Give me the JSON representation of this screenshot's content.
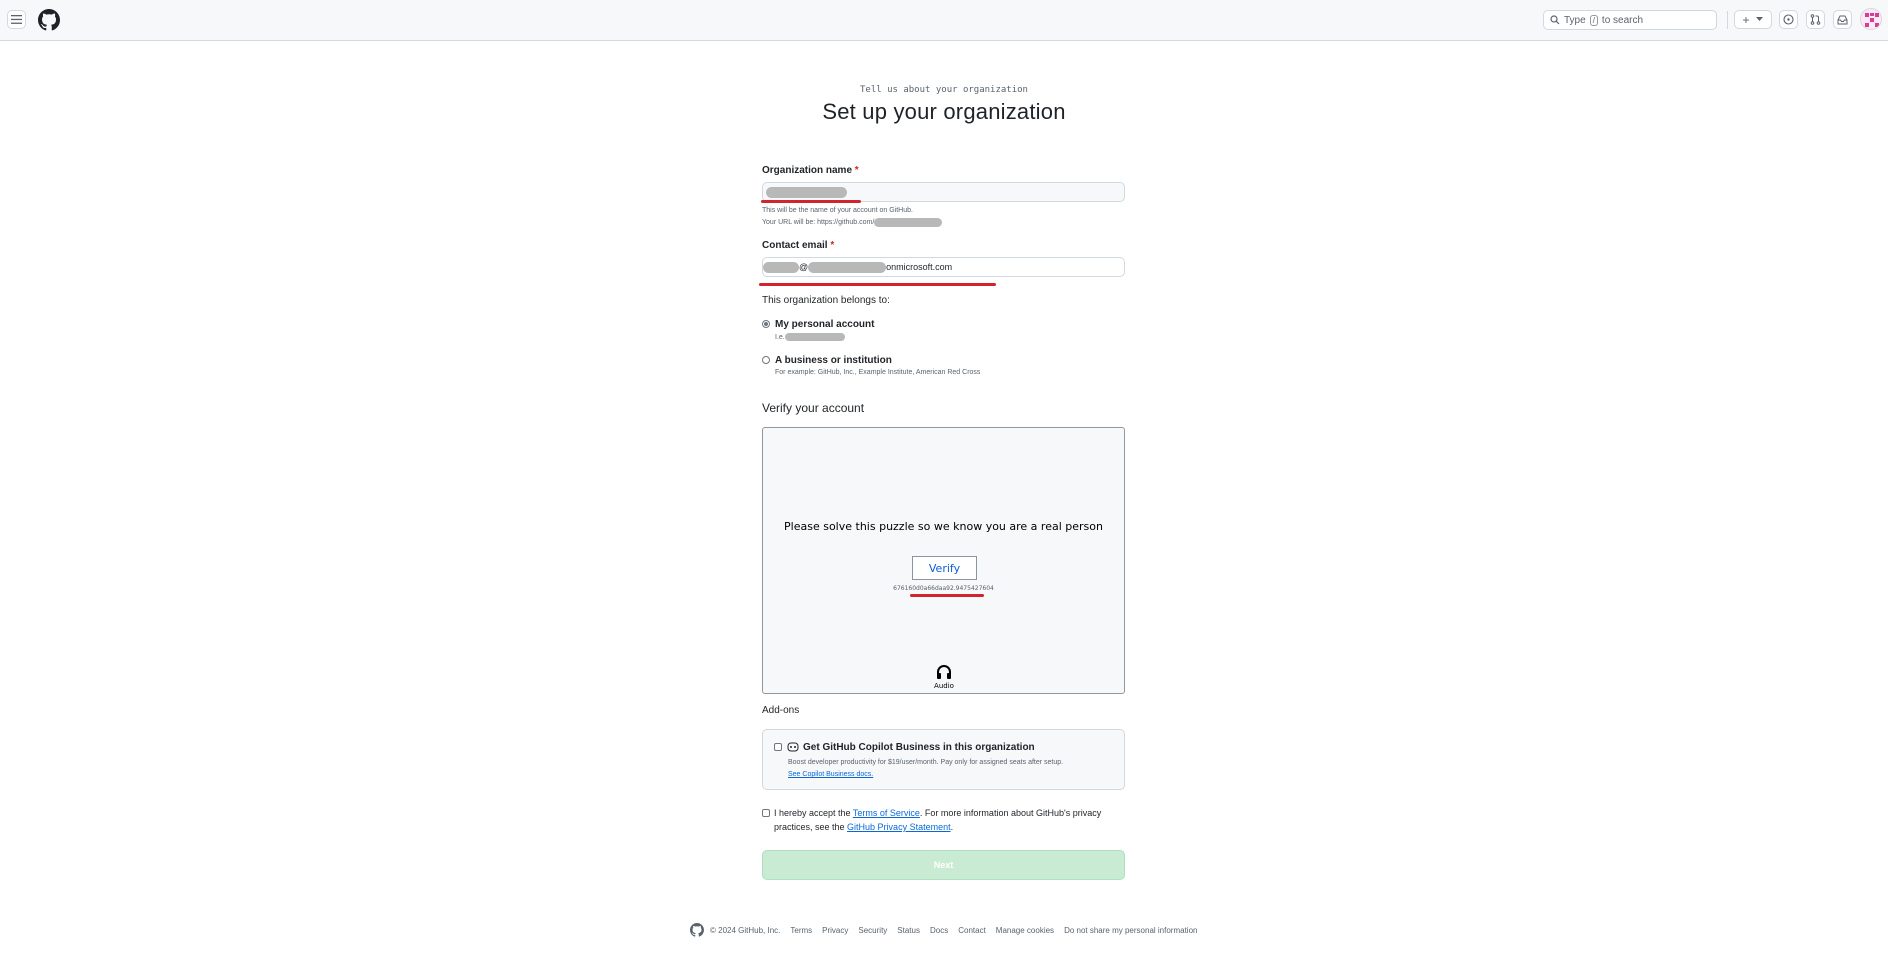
{
  "header": {
    "search_prefix": "Type",
    "search_key": "/",
    "search_suffix": "to search",
    "create_label": "+"
  },
  "page": {
    "subtitle": "Tell us about your organization",
    "title": "Set up your organization"
  },
  "form": {
    "org_name_label": "Organization name",
    "required_mark": "*",
    "org_name_help_1": "This will be the name of your account on GitHub.",
    "org_name_help_2": "Your URL will be: https://github.com/",
    "email_label": "Contact email",
    "email_value_suffix": "onmicrosoft.com",
    "email_at": "@",
    "belongs_label": "This organization belongs to:",
    "belongs_options": [
      {
        "title": "My personal account",
        "desc": "I.e.",
        "checked": true
      },
      {
        "title": "A business or institution",
        "desc": "For example: GitHub, Inc., Example Institute, American Red Cross",
        "checked": false
      }
    ],
    "verify_title": "Verify your account",
    "captcha_message": "Please solve this puzzle so we know you are a real person",
    "verify_button": "Verify",
    "captcha_id": "676160d0a66daa92.9475427604",
    "audio_label": "Audio",
    "addons_title": "Add-ons",
    "addon_title": "Get GitHub Copilot Business in this organization",
    "addon_desc": "Boost developer productivity for $19/user/month. Pay only for assigned seats after setup.",
    "addon_link": "See Copilot Business docs.",
    "terms_prefix": "I hereby accept the ",
    "terms_link": "Terms of Service",
    "terms_middle": ". For more information about GitHub's privacy practices, see the ",
    "privacy_link": "GitHub Privacy Statement",
    "terms_suffix": ".",
    "next_button": "Next"
  },
  "footer": {
    "copyright": "© 2024 GitHub, Inc.",
    "links": [
      "Terms",
      "Privacy",
      "Security",
      "Status",
      "Docs",
      "Contact",
      "Manage cookies",
      "Do not share my personal information"
    ]
  },
  "colors": {
    "accent_red": "#d1242f",
    "link": "#0969da",
    "next_disabled": "#c9ebd3"
  }
}
